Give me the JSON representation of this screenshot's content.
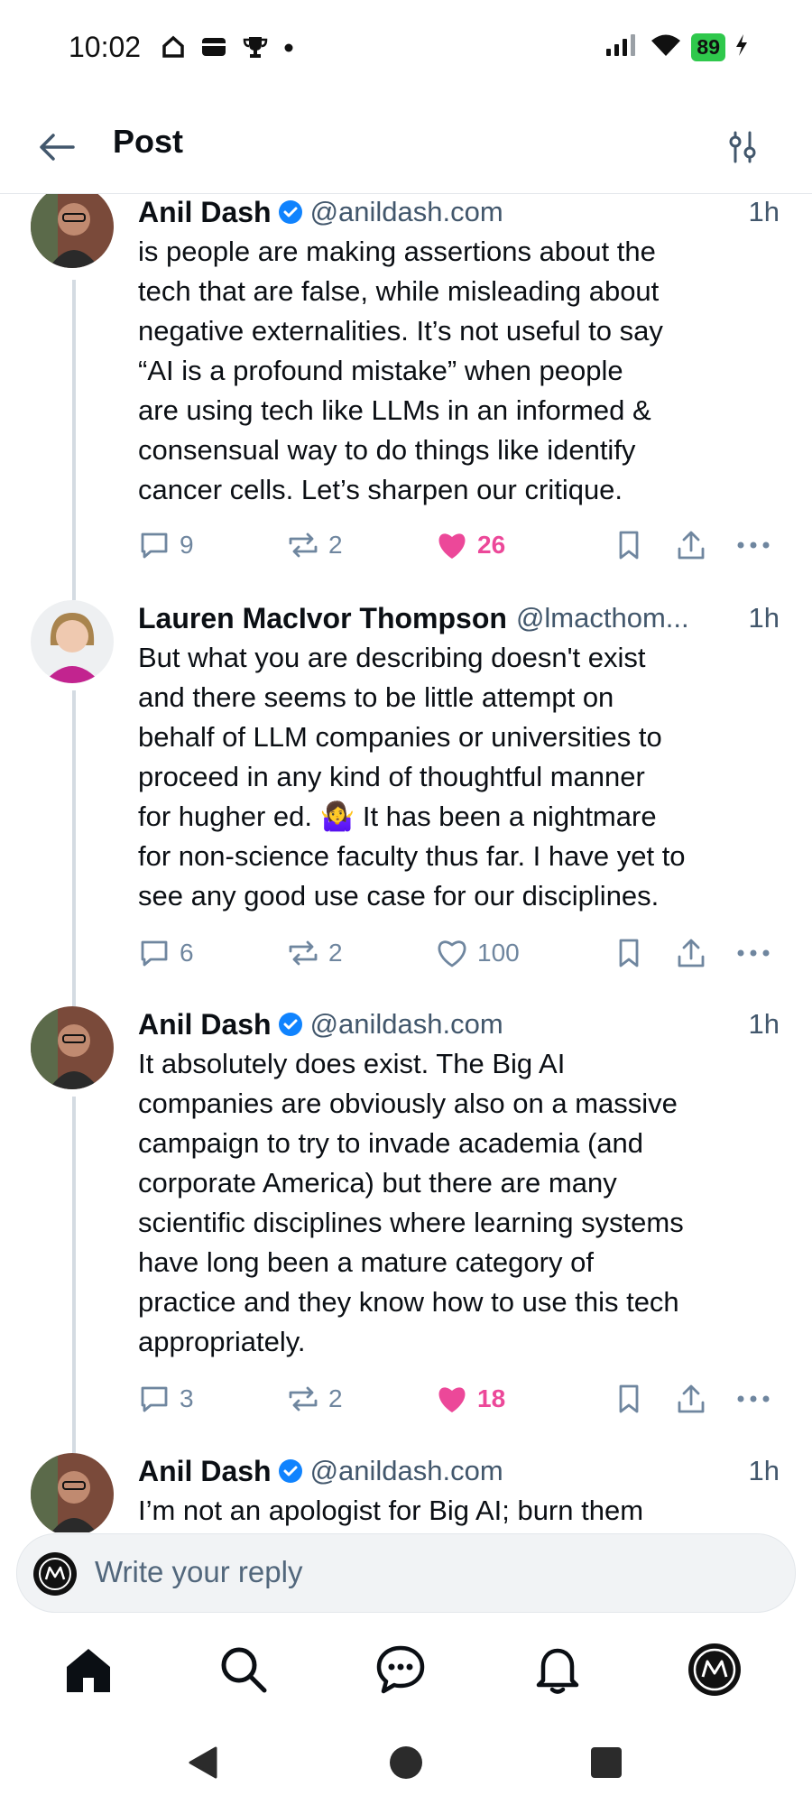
{
  "status_bar": {
    "time": "10:02",
    "battery": "89",
    "left_icons": [
      "home-icon",
      "wallet-icon",
      "trophy-icon",
      "dot-icon"
    ],
    "right_icons": [
      "signal-icon",
      "wifi-icon",
      "battery-icon",
      "charging-icon"
    ]
  },
  "header": {
    "title": "Post"
  },
  "posts": [
    {
      "author": "Anil Dash",
      "verified": true,
      "handle": "@anildash.com",
      "time": "1h",
      "text": "is people are making assertions about the\ntech that are false, while misleading about\nnegative externalities. It’s not useful to say\n“AI is a profound mistake” when people\nare using tech like LLMs in an informed &\nconsensual way to do things like identify\ncancer cells. Let’s sharpen our critique.",
      "replies": "9",
      "reposts": "2",
      "likes": "26",
      "liked": true
    },
    {
      "author": "Lauren MacIvor Thompson",
      "verified": false,
      "handle": "@lmacthom...",
      "time": "1h",
      "text": "But what you are describing doesn't exist\nand there seems to be little attempt on\nbehalf of LLM companies or universities to\nproceed in any kind of thoughtful manner\nfor hugher ed. 🤷‍♀️ It has been a nightmare\nfor non-science faculty thus far. I have yet to\nsee any good use case for our disciplines.",
      "replies": "6",
      "reposts": "2",
      "likes": "100",
      "liked": false
    },
    {
      "author": "Anil Dash",
      "verified": true,
      "handle": "@anildash.com",
      "time": "1h",
      "text": "It absolutely does exist. The Big AI\ncompanies are obviously also on a massive\ncampaign to try to invade academia (and\ncorporate America) but there are many\nscientific disciplines where learning systems\nhave long been a mature category of\npractice and they know how to use this tech\nappropriately.",
      "replies": "3",
      "reposts": "2",
      "likes": "18",
      "liked": true
    },
    {
      "author": "Anil Dash",
      "verified": true,
      "handle": "@anildash.com",
      "time": "1h",
      "text": "I’m not an apologist for Big AI; burn them"
    }
  ],
  "reply_bar": {
    "placeholder": "Write your reply"
  },
  "bottom_nav": [
    "home-icon",
    "search-icon",
    "chat-icon",
    "bell-icon",
    "profile-avatar"
  ],
  "system_nav": [
    "back-icon",
    "home-circle-icon",
    "recents-icon"
  ],
  "colors": {
    "accent": "#1083fe",
    "like": "#ec4899",
    "muted": "#6f869f"
  }
}
